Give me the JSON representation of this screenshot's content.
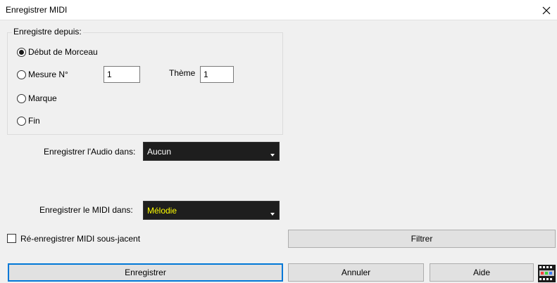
{
  "window": {
    "title": "Enregistrer MIDI"
  },
  "record_from": {
    "group_label": "Enregistre depuis:",
    "options": [
      {
        "label": "Début de Morceau",
        "selected": true
      },
      {
        "label": "Mesure N°",
        "selected": false
      },
      {
        "label": "Marque",
        "selected": false
      },
      {
        "label": "Fin",
        "selected": false
      }
    ],
    "measure_value": "1",
    "theme_label": "Thème",
    "theme_value": "1"
  },
  "audio": {
    "label": "Enregistrer l'Audio dans:",
    "value": "Aucun",
    "text_color": "#ffffff"
  },
  "midi": {
    "label": "Enregistrer le MIDI dans:",
    "value": "Mélodie",
    "text_color": "#ffff00"
  },
  "rerecord": {
    "label": "Ré-enregistrer MIDI sous-jacent",
    "checked": false
  },
  "buttons": {
    "filter": "Filtrer",
    "record": "Enregistrer",
    "cancel": "Annuler",
    "help": "Aide"
  },
  "icons": {
    "close": "close-icon",
    "extra": "film-strip-icon"
  }
}
